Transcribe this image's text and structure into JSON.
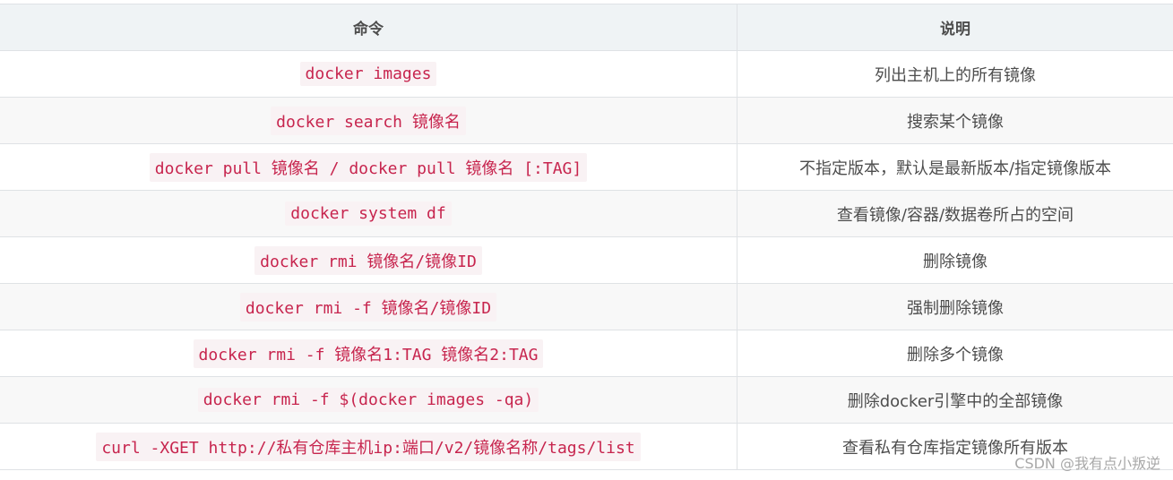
{
  "table": {
    "headers": {
      "command": "命令",
      "description": "说明"
    },
    "rows": [
      {
        "command": "docker images",
        "description": "列出主机上的所有镜像"
      },
      {
        "command": "docker search 镜像名",
        "description": "搜索某个镜像"
      },
      {
        "command": "docker pull 镜像名 / docker pull 镜像名 [:TAG]",
        "description": "不指定版本，默认是最新版本/指定镜像版本"
      },
      {
        "command": "docker system df",
        "description": "查看镜像/容器/数据卷所占的空间"
      },
      {
        "command": "docker rmi 镜像名/镜像ID",
        "description": "删除镜像"
      },
      {
        "command": "docker rmi -f 镜像名/镜像ID",
        "description": "强制删除镜像"
      },
      {
        "command": "docker rmi -f 镜像名1:TAG 镜像名2:TAG",
        "description": "删除多个镜像"
      },
      {
        "command": "docker rmi -f $(docker images -qa)",
        "description": "删除docker引擎中的全部镜像"
      },
      {
        "command": "curl -XGET http://私有仓库主机ip:端口/v2/镜像名称/tags/list",
        "description": "查看私有仓库指定镜像所有版本"
      }
    ]
  },
  "watermark": "CSDN @我有点小叛逆",
  "colors": {
    "code_text": "#c7254e",
    "code_background": "#f9f2f4",
    "header_background": "#eff3f5",
    "alt_row_background": "#f8f8f8",
    "border": "#dfe2e5"
  }
}
